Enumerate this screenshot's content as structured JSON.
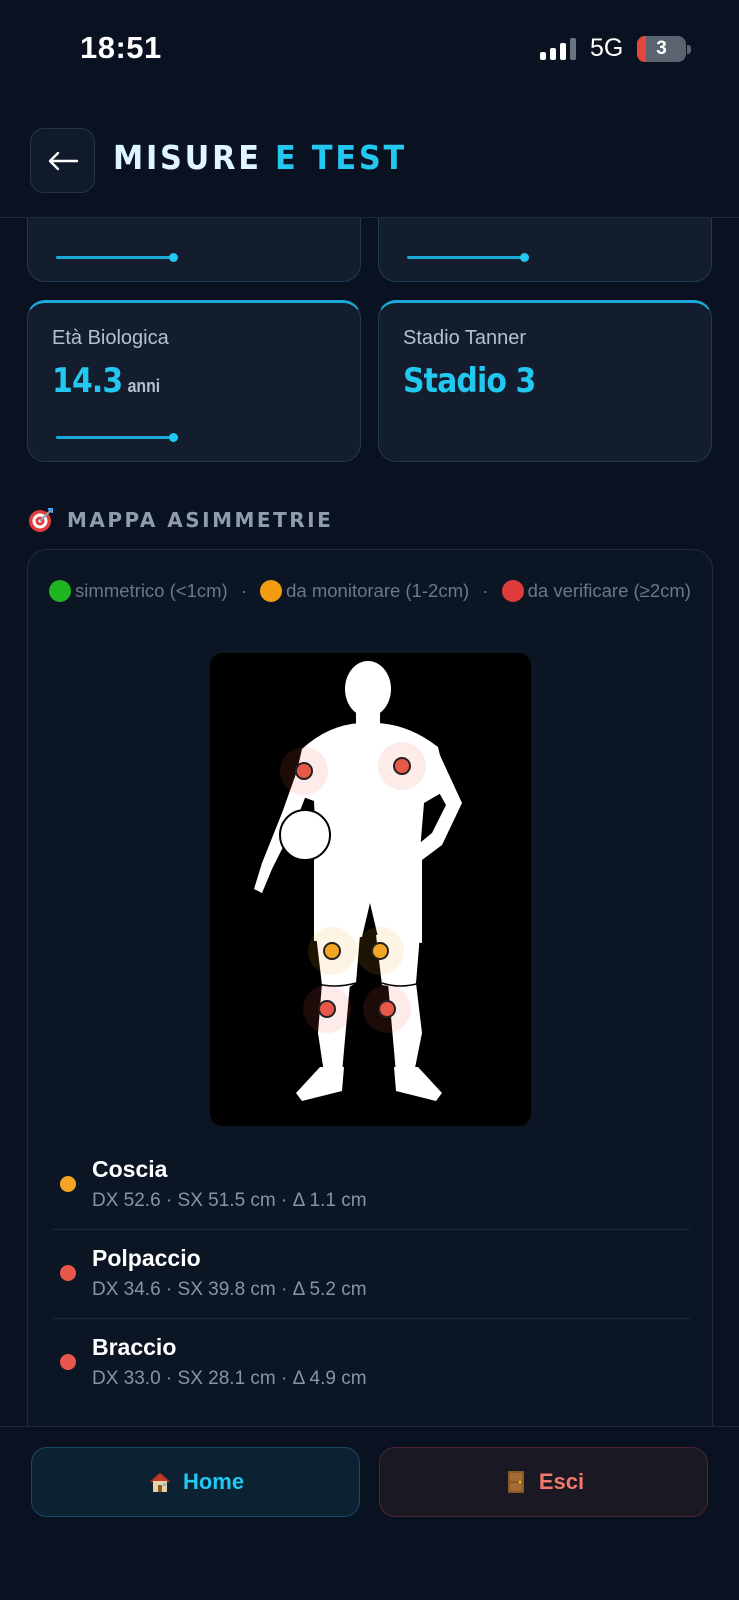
{
  "status_bar": {
    "time": "18:51",
    "network": "5G",
    "battery": "3"
  },
  "header": {
    "title_part1": "MISURE",
    "title_part2": "E TEST",
    "back_icon": "arrow-left-icon"
  },
  "metrics": [
    {
      "label": "Età Biologica",
      "value": "14.3",
      "unit": "anni",
      "progress": 0.37
    },
    {
      "label": "Stadio Tanner",
      "value": "Stadio 3",
      "unit": ""
    }
  ],
  "top_cards_progress": [
    0.37,
    0.37
  ],
  "asymmetry": {
    "section_title": "MAPPA ASIMMETRIE",
    "section_icon": "target-icon",
    "legend": [
      {
        "color": "#1fb51f",
        "text": "simmetrico (<1cm)"
      },
      {
        "color": "#f39c12",
        "text": "da monitorare (1-2cm)"
      },
      {
        "color": "#e03b3b",
        "text": "da verificare (≥2cm)"
      }
    ],
    "points": [
      {
        "name": "braccio-dx",
        "status": "red"
      },
      {
        "name": "braccio-sx",
        "status": "red"
      },
      {
        "name": "coscia-dx",
        "status": "orange"
      },
      {
        "name": "coscia-sx",
        "status": "orange"
      },
      {
        "name": "polpaccio-dx",
        "status": "red"
      },
      {
        "name": "polpaccio-sx",
        "status": "red"
      }
    ],
    "measurements": [
      {
        "name": "Coscia",
        "detail": "DX 52.6 · SX 51.5 cm  ·  Δ 1.1 cm",
        "color": "#f5a524"
      },
      {
        "name": "Polpaccio",
        "detail": "DX 34.6 · SX 39.8 cm  ·  Δ 5.2 cm",
        "color": "#e8584a"
      },
      {
        "name": "Braccio",
        "detail": "DX 33.0 · SX 28.1 cm  ·  Δ 4.9 cm",
        "color": "#e8584a"
      }
    ]
  },
  "bottom": {
    "home_label": "Home",
    "home_icon": "house-icon",
    "exit_label": "Esci",
    "exit_icon": "door-icon"
  },
  "colors": {
    "accent": "#22c8f0",
    "background": "#0a1120",
    "warning": "#f5a524",
    "danger": "#e8584a"
  }
}
